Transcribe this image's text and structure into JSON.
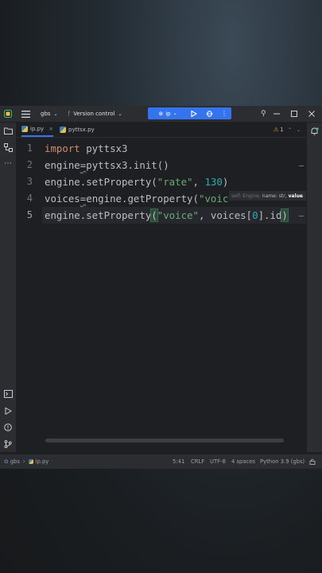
{
  "titlebar": {
    "project": "gbs",
    "vcs": "Version control",
    "run_config": "ip"
  },
  "tabs": [
    {
      "label": "ip.py",
      "active": true
    },
    {
      "label": "pyttsx.py",
      "active": false
    }
  ],
  "editor": {
    "line_numbers": [
      "1",
      "2",
      "3",
      "4",
      "5"
    ],
    "warnings_count": "1",
    "lines": [
      {
        "kw": "import",
        "rest": " pyttsx3"
      },
      {
        "a": "engine",
        "b": "=",
        "c": "pyttsx3.init()"
      },
      {
        "a": "engine.setProperty(",
        "s": "\"rate\"",
        "b": ", ",
        "n": "130",
        "c": ")"
      },
      {
        "a": "voices",
        "b": "=",
        "c": "engine.getProperty(",
        "s": "\"voic"
      },
      {
        "a": "engine.setProperty",
        "p1": "(",
        "s": "\"voice\"",
        "b": ", voices[",
        "n": "0",
        "c": "].id",
        "p2": ")"
      }
    ],
    "param_hint": {
      "muted": "self: Engine,",
      "normal": "name: str,",
      "bold": "value"
    }
  },
  "statusbar": {
    "breadcrumb": [
      "gbs",
      "ip.py"
    ],
    "position": "5:41",
    "line_sep": "CRLF",
    "encoding": "UTF-8",
    "indent": "4 spaces",
    "interpreter": "Python 3.9 (gbs)"
  },
  "colors": {
    "accent": "#3574f0",
    "keyword": "#cf8e6d",
    "string": "#6aab73",
    "number": "#2aacb8",
    "warning": "#e2b43c"
  }
}
